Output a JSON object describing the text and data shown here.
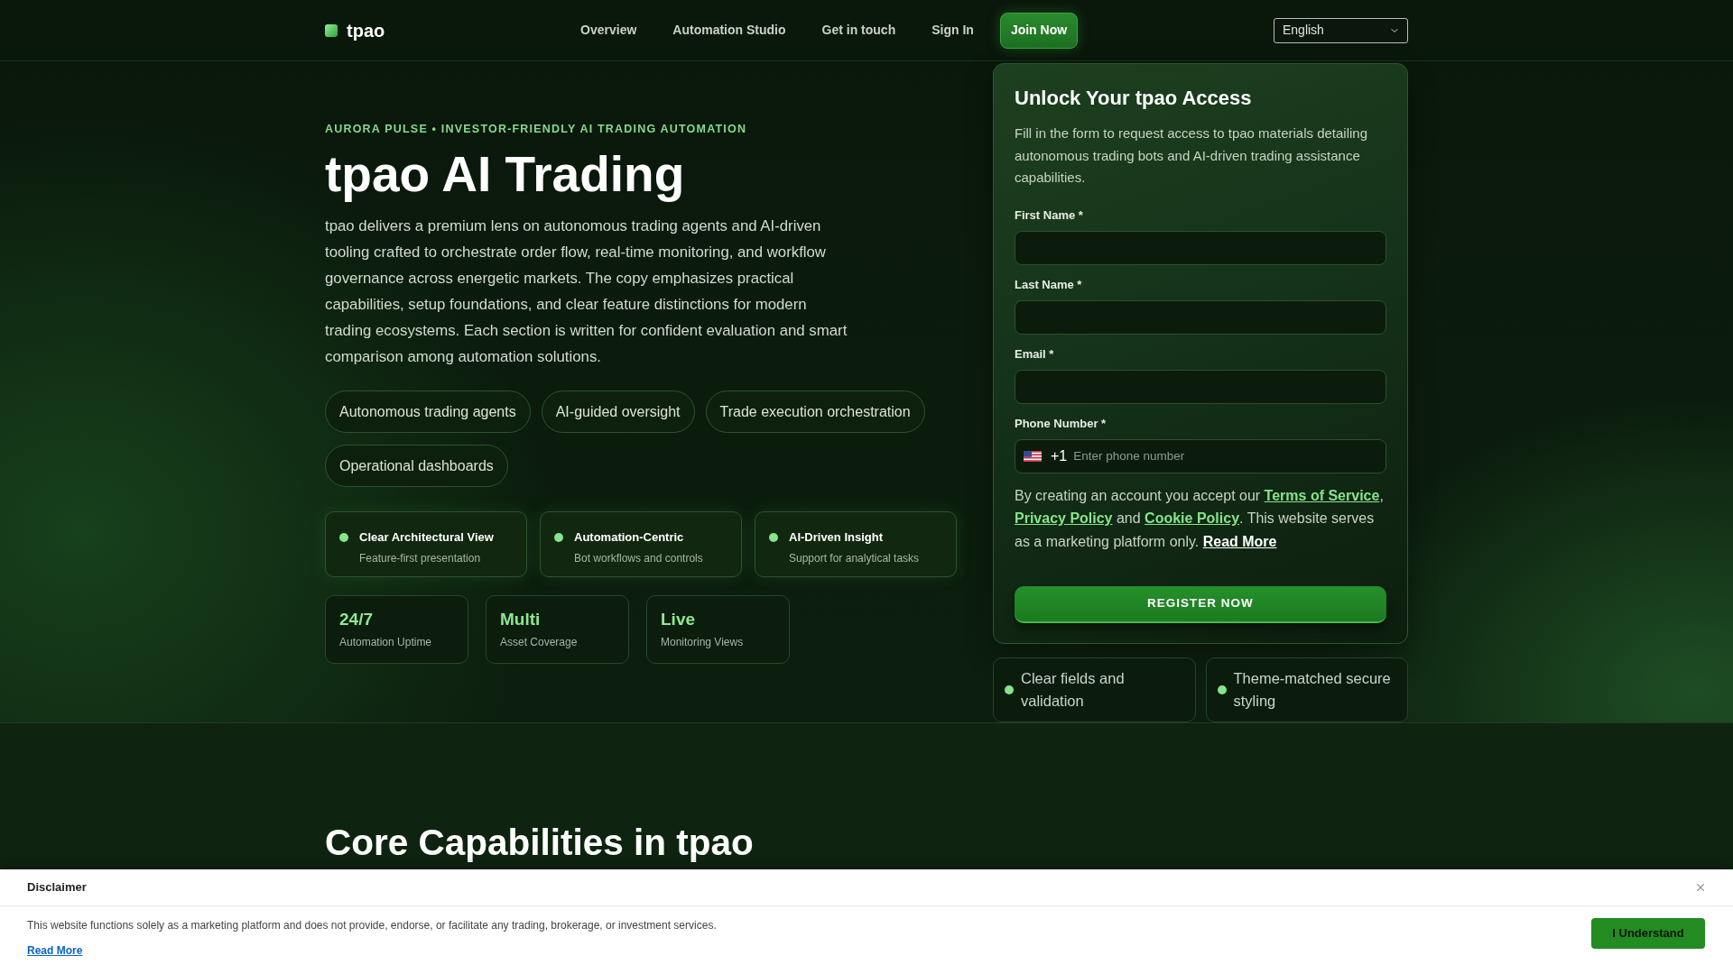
{
  "header": {
    "brand": "tpao",
    "nav": [
      {
        "label": "Overview"
      },
      {
        "label": "Automation Studio"
      },
      {
        "label": "Get in touch"
      },
      {
        "label": "Sign In"
      }
    ],
    "cta": "Join Now",
    "language": "English"
  },
  "hero": {
    "eyebrow": "AURORA PULSE • INVESTOR-FRIENDLY AI TRADING AUTOMATION",
    "title": "tpao AI Trading",
    "description": "tpao delivers a premium lens on autonomous trading agents and AI-driven tooling crafted to orchestrate order flow, real-time monitoring, and workflow governance across energetic markets. The copy emphasizes practical capabilities, setup foundations, and clear feature distinctions for modern trading ecosystems. Each section is written for confident evaluation and smart comparison among automation solutions.",
    "tags": [
      "Autonomous trading agents",
      "AI-guided oversight",
      "Trade execution orchestration",
      "Operational dashboards"
    ],
    "features": [
      {
        "title": "Clear Architectural View",
        "subtitle": "Feature-first presentation"
      },
      {
        "title": "Automation-Centric",
        "subtitle": "Bot workflows and controls"
      },
      {
        "title": "AI-Driven Insight",
        "subtitle": "Support for analytical tasks"
      }
    ],
    "stats": [
      {
        "value": "24/7",
        "label": "Automation Uptime"
      },
      {
        "value": "Multi",
        "label": "Asset Coverage"
      },
      {
        "value": "Live",
        "label": "Monitoring Views"
      }
    ]
  },
  "signup": {
    "title": "Unlock Your tpao Access",
    "description": "Fill in the form to request access to tpao materials detailing autonomous trading bots and AI-driven trading assistance capabilities.",
    "fields": [
      {
        "kind": "text",
        "label": "First Name *"
      },
      {
        "kind": "text",
        "label": "Last Name *"
      },
      {
        "kind": "text",
        "label": "Email *"
      },
      {
        "kind": "phone",
        "label": "Phone Number *",
        "country_code": "+1",
        "placeholder": "Enter phone number"
      }
    ],
    "consent": [
      {
        "kind": "text",
        "text": "By creating an account you accept our "
      },
      {
        "kind": "link",
        "text": "Terms of Service"
      },
      {
        "kind": "text",
        "text": ", "
      },
      {
        "kind": "link",
        "text": "Privacy Policy"
      },
      {
        "kind": "text",
        "text": " and "
      },
      {
        "kind": "link",
        "text": "Cookie Policy"
      },
      {
        "kind": "text",
        "text": ". This website serves as a marketing platform only. "
      },
      {
        "kind": "more",
        "text": "Read More"
      }
    ],
    "submit": "REGISTER NOW",
    "notes": [
      "Clear fields and validation",
      "Theme-matched secure styling"
    ]
  },
  "capabilities": {
    "title": "Core Capabilities in tpao"
  },
  "disclaimer": {
    "title": "Disclaimer",
    "text": "This website functions solely as a marketing platform and does not provide, endorse, or facilitate any trading, brokerage, or investment services.",
    "link": "Read More",
    "button": "I Understand"
  }
}
